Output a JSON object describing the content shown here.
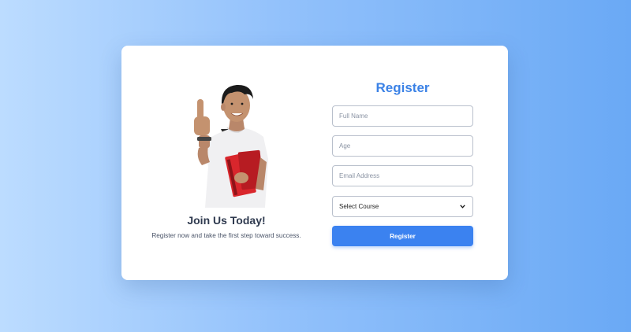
{
  "promo": {
    "image": "student-thumbs-up-with-books",
    "title": "Join Us Today!",
    "subtitle": "Register now and take the first step toward success."
  },
  "form": {
    "title": "Register",
    "full_name_placeholder": "Full Name",
    "age_placeholder": "Age",
    "email_placeholder": "Email Address",
    "course_selected": "Select Course",
    "submit_label": "Register"
  },
  "colors": {
    "accent": "#3b82f0",
    "title_blue": "#3b82e6",
    "background_start": "#bcdcff",
    "background_end": "#6aa9f5"
  },
  "icons": {
    "select_arrow": "chevron-down-icon"
  }
}
